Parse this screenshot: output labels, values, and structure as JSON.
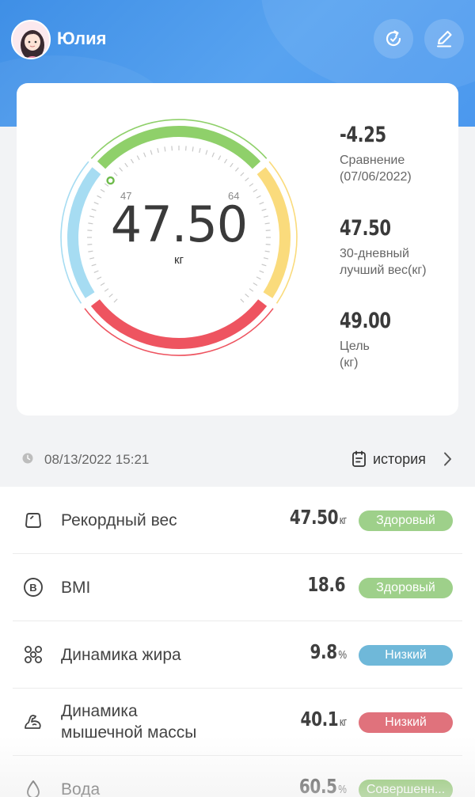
{
  "header": {
    "user_name": "Юлия",
    "refresh_icon": "refresh-icon",
    "edit_icon": "edit-icon",
    "background_color": "#4b98ee"
  },
  "gauge": {
    "weight": "47.50",
    "unit": "кг",
    "range_low_label": "47",
    "range_high_label": "64",
    "colors": {
      "underweight": "#a6dcf2",
      "healthy": "#8fd06a",
      "overweight": "#fadb7c",
      "obese": "#ee5460"
    }
  },
  "stats": [
    {
      "value": "-4.25",
      "label": "Сравнение\n(07/06/2022)"
    },
    {
      "value": "47.50",
      "label": "30-дневный\n лучший вес(кг)"
    },
    {
      "value": "49.00",
      "label": "Цель\n(кг)"
    }
  ],
  "timeline": {
    "timestamp": "08/13/2022 15:21",
    "history_label": "история"
  },
  "metrics": [
    {
      "icon": "scale-icon",
      "name": "Рекордный вес",
      "value": "47.50",
      "unit": "кг",
      "status": "Здоровый",
      "status_color": "#9ed08a"
    },
    {
      "icon": "bmi-icon",
      "name": "BMI",
      "value": "18.6",
      "unit": "",
      "status": "Здоровый",
      "status_color": "#9ed08a"
    },
    {
      "icon": "fat-icon",
      "name": "Динамика жира",
      "value": "9.8",
      "unit": "%",
      "status": "Низкий",
      "status_color": "#6fb8d9"
    },
    {
      "icon": "muscle-icon",
      "name": "Динамика\nмышечной массы",
      "value": "40.1",
      "unit": "кг",
      "status": "Низкий",
      "status_color": "#e0727c"
    },
    {
      "icon": "water-icon",
      "name": "Вода",
      "value": "60.5",
      "unit": "%",
      "status": "Совершенн...",
      "status_color": "#7fbf5a"
    }
  ]
}
